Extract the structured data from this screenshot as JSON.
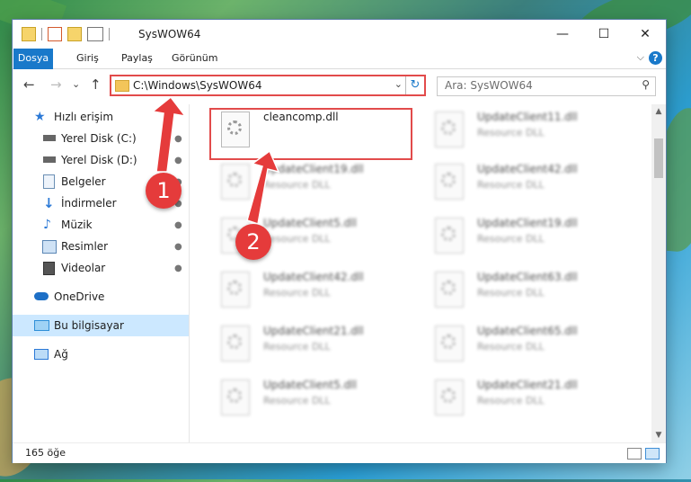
{
  "window": {
    "title": "SysWOW64",
    "controls": {
      "minimize": "—",
      "maximize": "☐",
      "close": "✕"
    }
  },
  "ribbon": {
    "tabs": [
      "Dosya",
      "Giriş",
      "Paylaş",
      "Görünüm"
    ],
    "help_label": "?",
    "collapse_label": "⌵"
  },
  "nav": {
    "back": "←",
    "forward": "→",
    "recent": "⌄",
    "up": "↑",
    "address": "C:\\Windows\\SysWOW64",
    "address_dropdown": "⌄",
    "refresh": "↻",
    "search_placeholder": "Ara: SysWOW64",
    "search_icon": "⚲"
  },
  "sidebar": {
    "items": [
      {
        "label": "Hızlı erişim",
        "icon": "star-icon",
        "color": "#2b79d6"
      },
      {
        "label": "Yerel Disk (C:)",
        "icon": "drive-icon",
        "color": "#444444",
        "pinned": true
      },
      {
        "label": "Yerel Disk (D:)",
        "icon": "drive-icon",
        "color": "#444444",
        "pinned": true
      },
      {
        "label": "Belgeler",
        "icon": "documents-icon",
        "color": "#6a8fb4",
        "pinned": true
      },
      {
        "label": "İndirmeler",
        "icon": "download-icon",
        "color": "#2b79d6",
        "pinned": true
      },
      {
        "label": "Müzik",
        "icon": "music-icon",
        "color": "#2b79d6",
        "pinned": true
      },
      {
        "label": "Resimler",
        "icon": "pictures-icon",
        "color": "#5a86b5",
        "pinned": true
      },
      {
        "label": "Videolar",
        "icon": "videos-icon",
        "color": "#555555",
        "pinned": true
      },
      {
        "label": "OneDrive",
        "icon": "cloud-icon",
        "color": "#1d6fc6"
      },
      {
        "label": "Bu bilgisayar",
        "icon": "computer-icon",
        "color": "#2f8fd8",
        "selected": true
      },
      {
        "label": "Ağ",
        "icon": "network-icon",
        "color": "#2b79d6"
      }
    ],
    "pin_glyph": "📌"
  },
  "files": {
    "column1": [
      {
        "name": "cleancomp.dll",
        "type": ""
      },
      {
        "name": "UpdateClient19.dll",
        "type": "Resource DLL"
      },
      {
        "name": "UpdateClient5.dll",
        "type": "Resource DLL"
      },
      {
        "name": "UpdateClient42.dll",
        "type": "Resource DLL"
      },
      {
        "name": "UpdateClient21.dll",
        "type": "Resource DLL"
      },
      {
        "name": "UpdateClient5.dll",
        "type": "Resource DLL"
      }
    ],
    "column2": [
      {
        "name": "UpdateClient11.dll",
        "type": "Resource DLL"
      },
      {
        "name": "UpdateClient42.dll",
        "type": "Resource DLL"
      },
      {
        "name": "UpdateClient19.dll",
        "type": "Resource DLL"
      },
      {
        "name": "UpdateClient63.dll",
        "type": "Resource DLL"
      },
      {
        "name": "UpdateClient65.dll",
        "type": "Resource DLL"
      },
      {
        "name": "UpdateClient21.dll",
        "type": "Resource DLL"
      }
    ]
  },
  "status": {
    "item_count": "165 öğe"
  },
  "scrollbar": {
    "up": "▲",
    "down": "▼"
  },
  "annotations": {
    "step1": "1",
    "step2": "2",
    "color": "#e53b3b"
  }
}
